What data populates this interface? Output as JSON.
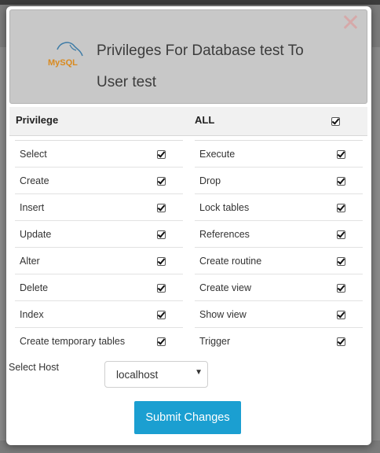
{
  "header": {
    "title": "Privileges For Database test To User test",
    "logo_text": "MySQL",
    "close_glyph": "✕"
  },
  "columns": {
    "privilege_label": "Privilege",
    "all_label": "ALL",
    "all_checked": true
  },
  "privileges_left": [
    {
      "label": "Select",
      "checked": true
    },
    {
      "label": "Create",
      "checked": true
    },
    {
      "label": "Insert",
      "checked": true
    },
    {
      "label": "Update",
      "checked": true
    },
    {
      "label": "Alter",
      "checked": true
    },
    {
      "label": "Delete",
      "checked": true
    },
    {
      "label": "Index",
      "checked": true
    },
    {
      "label": "Create temporary tables",
      "checked": true
    }
  ],
  "privileges_right": [
    {
      "label": "Execute",
      "checked": true
    },
    {
      "label": "Drop",
      "checked": true
    },
    {
      "label": "Lock tables",
      "checked": true
    },
    {
      "label": "References",
      "checked": true
    },
    {
      "label": "Create routine",
      "checked": true
    },
    {
      "label": "Create view",
      "checked": true
    },
    {
      "label": "Show view",
      "checked": true
    },
    {
      "label": "Trigger",
      "checked": true
    }
  ],
  "host": {
    "label": "Select Host",
    "value": "localhost"
  },
  "submit_label": "Submit Changes",
  "colors": {
    "accent": "#1b9fd1",
    "header_bg": "#c8c8c8",
    "overlay": "#7b7b7b"
  }
}
